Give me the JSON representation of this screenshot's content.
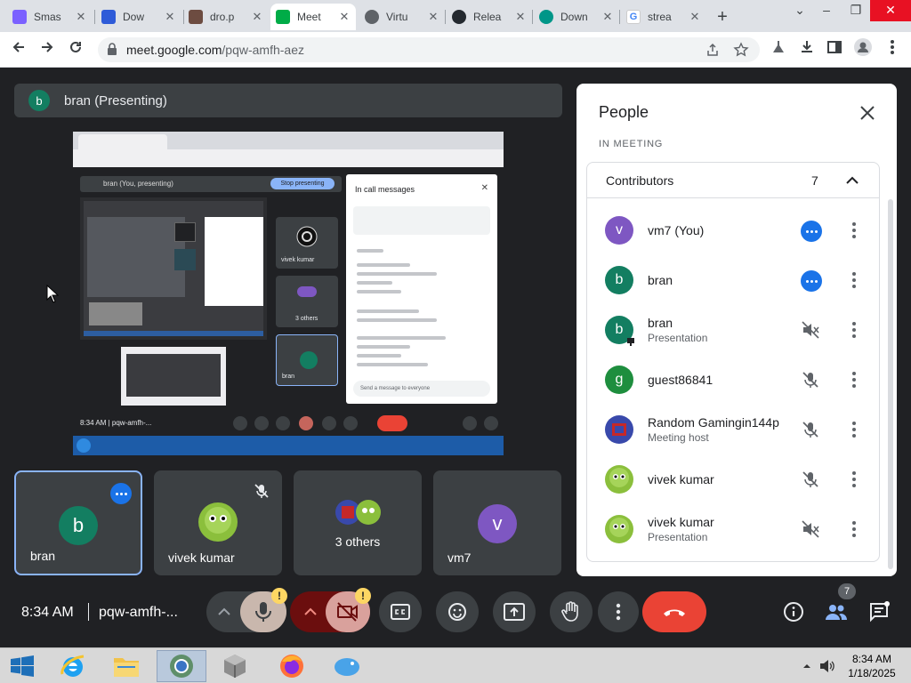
{
  "browser": {
    "tabs": [
      {
        "title": "Smas",
        "color": "#7b61ff"
      },
      {
        "title": "Dow",
        "color": "#2e5bd8"
      },
      {
        "title": "dro.p",
        "color": "#6d4c41"
      },
      {
        "title": "Meet",
        "color": "#00ac47"
      },
      {
        "title": "Virtu",
        "color": "#5f6368"
      },
      {
        "title": "Relea",
        "color": "#24292f"
      },
      {
        "title": "Down",
        "color": "#009688"
      },
      {
        "title": "strea",
        "color": "#4285f4"
      }
    ],
    "url_host": "meet.google.com",
    "url_path": "/pqw-amfh-aez"
  },
  "stage": {
    "presenter_initial": "b",
    "presenter_label": "bran (Presenting)",
    "screen": {
      "header": "bran (You, presenting)",
      "stop_button": "Stop presenting",
      "chat_title": "In call messages",
      "chat_input": "Send a message to everyone",
      "time_code": "8:34 AM  |  pqw-amfh-...",
      "tiles": [
        "vivek kumar",
        "3 others",
        "bran"
      ]
    }
  },
  "tiles": [
    {
      "name": "bran",
      "initial": "b",
      "color": "#137e61"
    },
    {
      "name": "vivek kumar"
    },
    {
      "name": "3 others"
    },
    {
      "name": "vm7",
      "initial": "v",
      "color": "#7e57c2"
    }
  ],
  "meeting": {
    "time": "8:34 AM",
    "code": "pqw-amfh-...",
    "participant_count": "7",
    "warning_mark": "!"
  },
  "people_panel": {
    "title": "People",
    "section": "IN MEETING",
    "group": "Contributors",
    "group_count": "7",
    "participants": [
      {
        "name": "vm7 (You)",
        "sub": "",
        "initial": "v",
        "color": "#7e57c2",
        "status": "speaking-dots"
      },
      {
        "name": "bran",
        "sub": "",
        "initial": "b",
        "color": "#137e61",
        "status": "speaking-dots"
      },
      {
        "name": "bran",
        "sub": "Presentation",
        "initial": "b",
        "color": "#137e61",
        "status": "presentation-muted"
      },
      {
        "name": "guest86841",
        "sub": "",
        "initial": "g",
        "color": "#1e8e3e",
        "status": "mic-muted"
      },
      {
        "name": "Random Gamingin144p",
        "sub": "Meeting host",
        "initial": "",
        "color": "#3949ab",
        "status": "mic-muted"
      },
      {
        "name": "vivek kumar",
        "sub": "",
        "initial": "",
        "color": "#9ccc65",
        "status": "mic-muted"
      },
      {
        "name": "vivek kumar",
        "sub": "Presentation",
        "initial": "",
        "color": "#9ccc65",
        "status": "presentation-muted"
      }
    ]
  },
  "taskbar": {
    "time": "8:34 AM",
    "date": "1/18/2025"
  }
}
